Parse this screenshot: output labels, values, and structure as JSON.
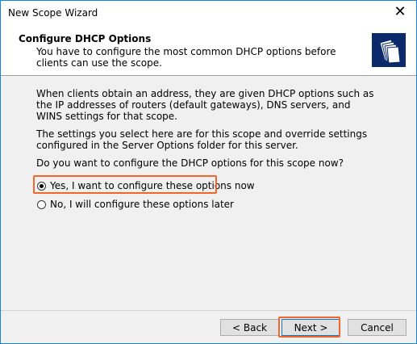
{
  "window": {
    "title": "New Scope Wizard",
    "close_glyph": "✕"
  },
  "header": {
    "title": "Configure DHCP Options",
    "subtitle": "You have to configure the most common DHCP options before clients can use the scope.",
    "icon": "folders-icon"
  },
  "content": {
    "paragraph1": "When clients obtain an address, they are given DHCP options such as the IP addresses of routers (default gateways), DNS servers, and WINS settings for that scope.",
    "paragraph2": "The settings you select here are for this scope and override settings configured in the Server Options folder for this server.",
    "question": "Do you want to configure the DHCP options for this scope now?",
    "options": [
      {
        "label": "Yes, I want to configure these options now",
        "selected": true
      },
      {
        "label": "No, I will configure these options later",
        "selected": false
      }
    ]
  },
  "footer": {
    "back_label": "< Back",
    "next_label": "Next >",
    "cancel_label": "Cancel"
  },
  "colors": {
    "highlight": "#f1662a",
    "accent": "#0078d7"
  }
}
